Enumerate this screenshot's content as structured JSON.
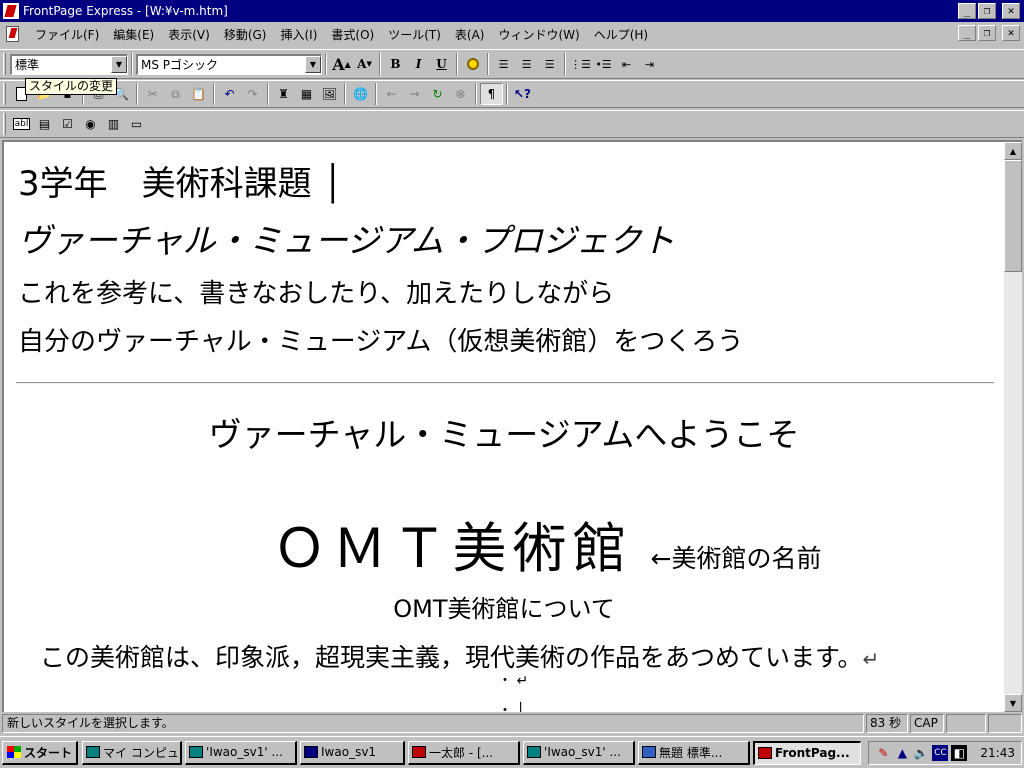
{
  "window": {
    "title": "FrontPage Express - [W:¥v-m.htm]"
  },
  "menu": [
    "ファイル(F)",
    "編集(E)",
    "表示(V)",
    "移動(G)",
    "挿入(I)",
    "書式(O)",
    "ツール(T)",
    "表(A)",
    "ウィンドウ(W)",
    "ヘルプ(H)"
  ],
  "toolbar": {
    "style_value": "標準",
    "font_value": "MS Pゴシック",
    "tooltip": "スタイルの変更",
    "bold": "B",
    "italic": "I",
    "underline": "U",
    "paragraph_mark": "¶",
    "help_what": "?"
  },
  "document": {
    "line1": "3学年　美術科課題 │",
    "line2": "ヴァーチャル・ミュージアム・プロジェクト",
    "line3": "これを参考に、書きなおしたり、加えたりしながら",
    "line4": "自分のヴァーチャル・ミュージアム（仮想美術館）をつくろう",
    "welcome": "ヴァーチャル・ミュージアムへようこそ",
    "museum_name": "ＯＭＴ美術館",
    "museum_note": "←美術館の名前",
    "about": "OMT美術館について",
    "description": "この美術館は、印象派，超現実主義，現代美術の作品をあつめています。",
    "return_mark": "↵",
    "bullet1": "・ ↵",
    "bullet2": "・ │"
  },
  "status": {
    "message": "新しいスタイルを選択します。",
    "time_estimate": "83 秒",
    "caps": "CAP"
  },
  "taskbar": {
    "start": "スタート",
    "tasks": [
      "マイ コンピュータ",
      "'Iwao_sv1' ...",
      "Iwao_sv1",
      "一太郎 - [...",
      "'Iwao_sv1' ...",
      "無題 標準...",
      "FrontPag..."
    ],
    "clock": "21:43"
  }
}
